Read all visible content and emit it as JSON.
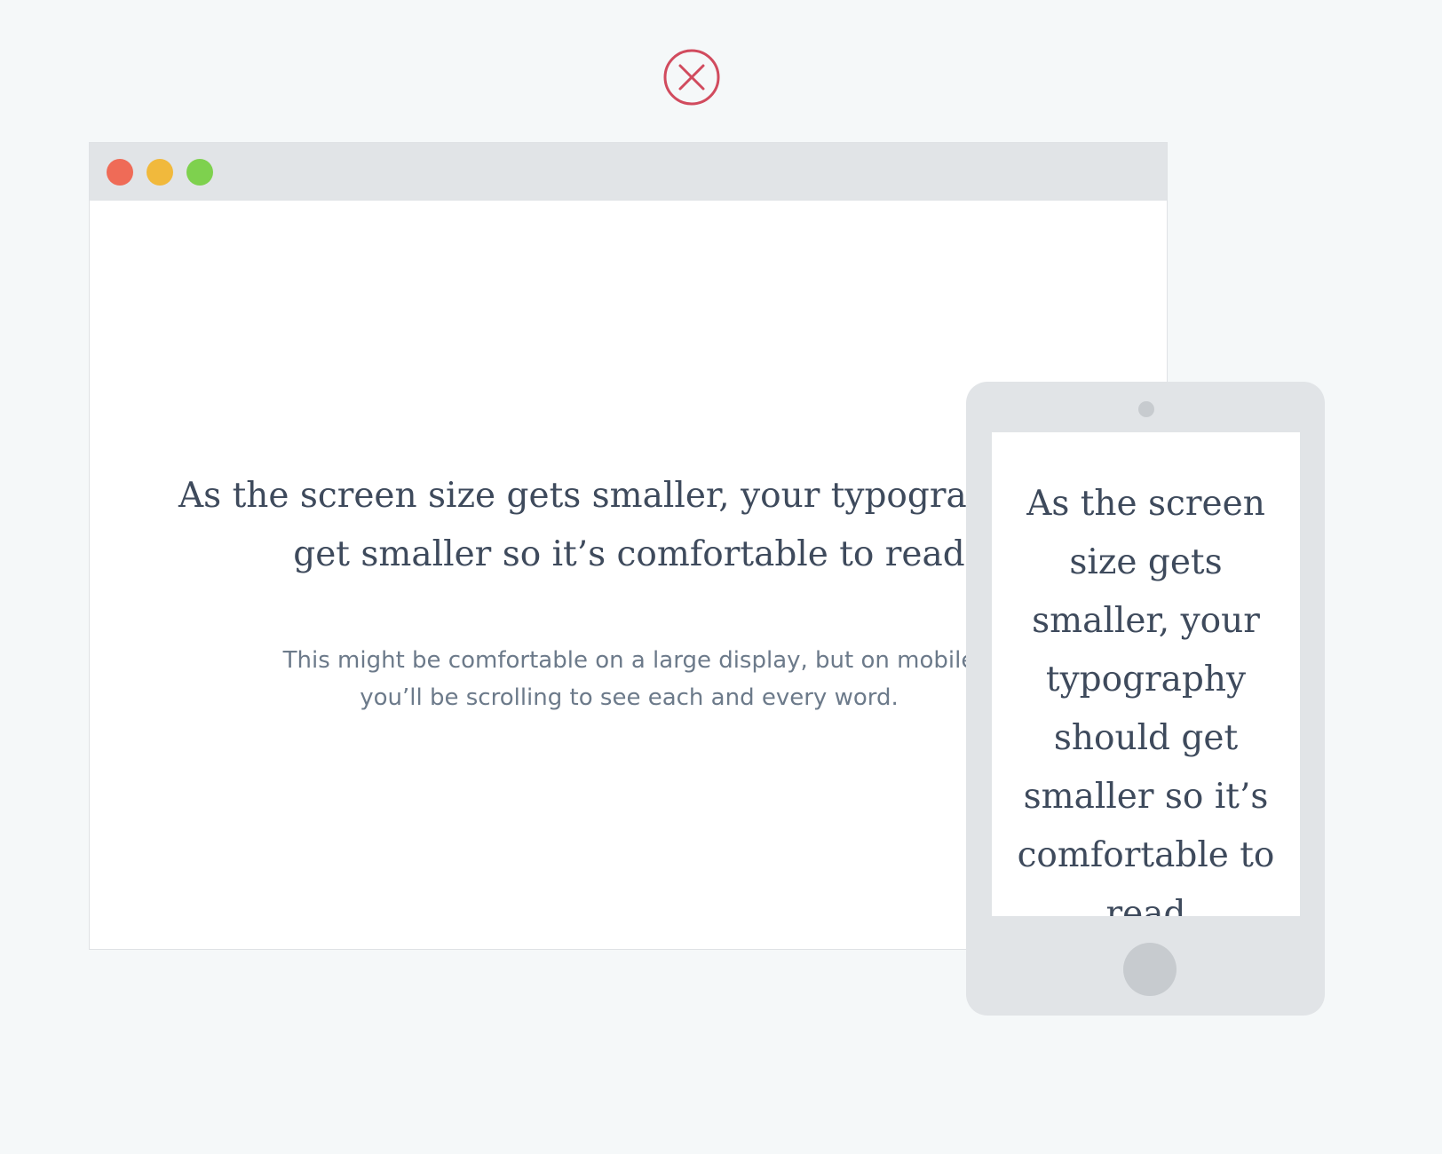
{
  "status": {
    "icon": "close-circle-icon",
    "color": "#d14b5e"
  },
  "desktop": {
    "window_controls": [
      {
        "name": "close",
        "color": "#ef6b57"
      },
      {
        "name": "minimize",
        "color": "#f1b93c"
      },
      {
        "name": "maximize",
        "color": "#7ed14e"
      }
    ],
    "headline_lines": [
      "As the screen size gets smaller, your typography should",
      "get smaller so it’s comfortable to read"
    ],
    "body_lines": [
      "This might be comfortable on a large display, but on mobile",
      "you’ll be scrolling to see each and every word."
    ]
  },
  "mobile": {
    "headline_lines": [
      "As the screen",
      "size gets",
      "smaller, your",
      "typography",
      "should get",
      "smaller so it’s",
      "comfortable to",
      "read"
    ]
  },
  "colors": {
    "background": "#f5f8f9",
    "frame": "#e1e4e7",
    "heading_text": "#3e4a5c",
    "body_text": "#6c7a8a"
  }
}
